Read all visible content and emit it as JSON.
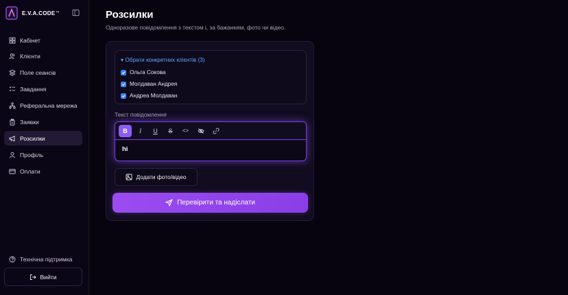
{
  "brand": {
    "name": "E.V.A.CODE",
    "trademark": "™",
    "accent": "#a855f7"
  },
  "nav": [
    {
      "label": "Кабінет",
      "icon": "dashboard-icon",
      "active": false
    },
    {
      "label": "Клієнти",
      "icon": "users-icon",
      "active": false
    },
    {
      "label": "Поле сеансів",
      "icon": "layers-icon",
      "active": false
    },
    {
      "label": "Завдання",
      "icon": "tasks-icon",
      "active": false
    },
    {
      "label": "Реферальна мережа",
      "icon": "network-icon",
      "active": false
    },
    {
      "label": "Заявки",
      "icon": "clipboard-icon",
      "active": false
    },
    {
      "label": "Розсилки",
      "icon": "megaphone-icon",
      "active": true
    },
    {
      "label": "Профіль",
      "icon": "user-icon",
      "active": false
    },
    {
      "label": "Оплати",
      "icon": "card-icon",
      "active": false
    }
  ],
  "footer": {
    "support_label": "Технічна підтримка",
    "logout_label": "Вийти"
  },
  "page": {
    "title": "Розсилки",
    "subtitle": "Одноразове повідомлення з текстом і, за бажанням, фото чи відео."
  },
  "clients": {
    "toggle_label": "▾ Обрати конкретних клієнтів (3)",
    "items": [
      {
        "name": "Ольга Сокова",
        "checked": true
      },
      {
        "name": "Молдаван Андрея",
        "checked": true
      },
      {
        "name": "Андреа Молдаван",
        "checked": true
      }
    ]
  },
  "editor": {
    "label": "Текст повідомлення",
    "value": "hi",
    "toolbar": [
      {
        "name": "bold-icon",
        "glyph": "B",
        "active": true
      },
      {
        "name": "italic-icon",
        "glyph": "I",
        "active": false
      },
      {
        "name": "underline-icon",
        "glyph": "U",
        "active": false
      },
      {
        "name": "strikethrough-icon",
        "glyph": "S",
        "active": false
      },
      {
        "name": "code-icon",
        "glyph": "<>",
        "active": false
      },
      {
        "name": "spoiler-icon",
        "glyph": "",
        "active": false
      },
      {
        "name": "link-icon",
        "glyph": "",
        "active": false
      }
    ]
  },
  "actions": {
    "add_media_label": "Додати фото/відео",
    "send_label": "Перевірити та надіслати"
  },
  "colors": {
    "primary": "#8b5cf6",
    "checkbox": "#3b82f6",
    "link": "#5aa7ff"
  }
}
